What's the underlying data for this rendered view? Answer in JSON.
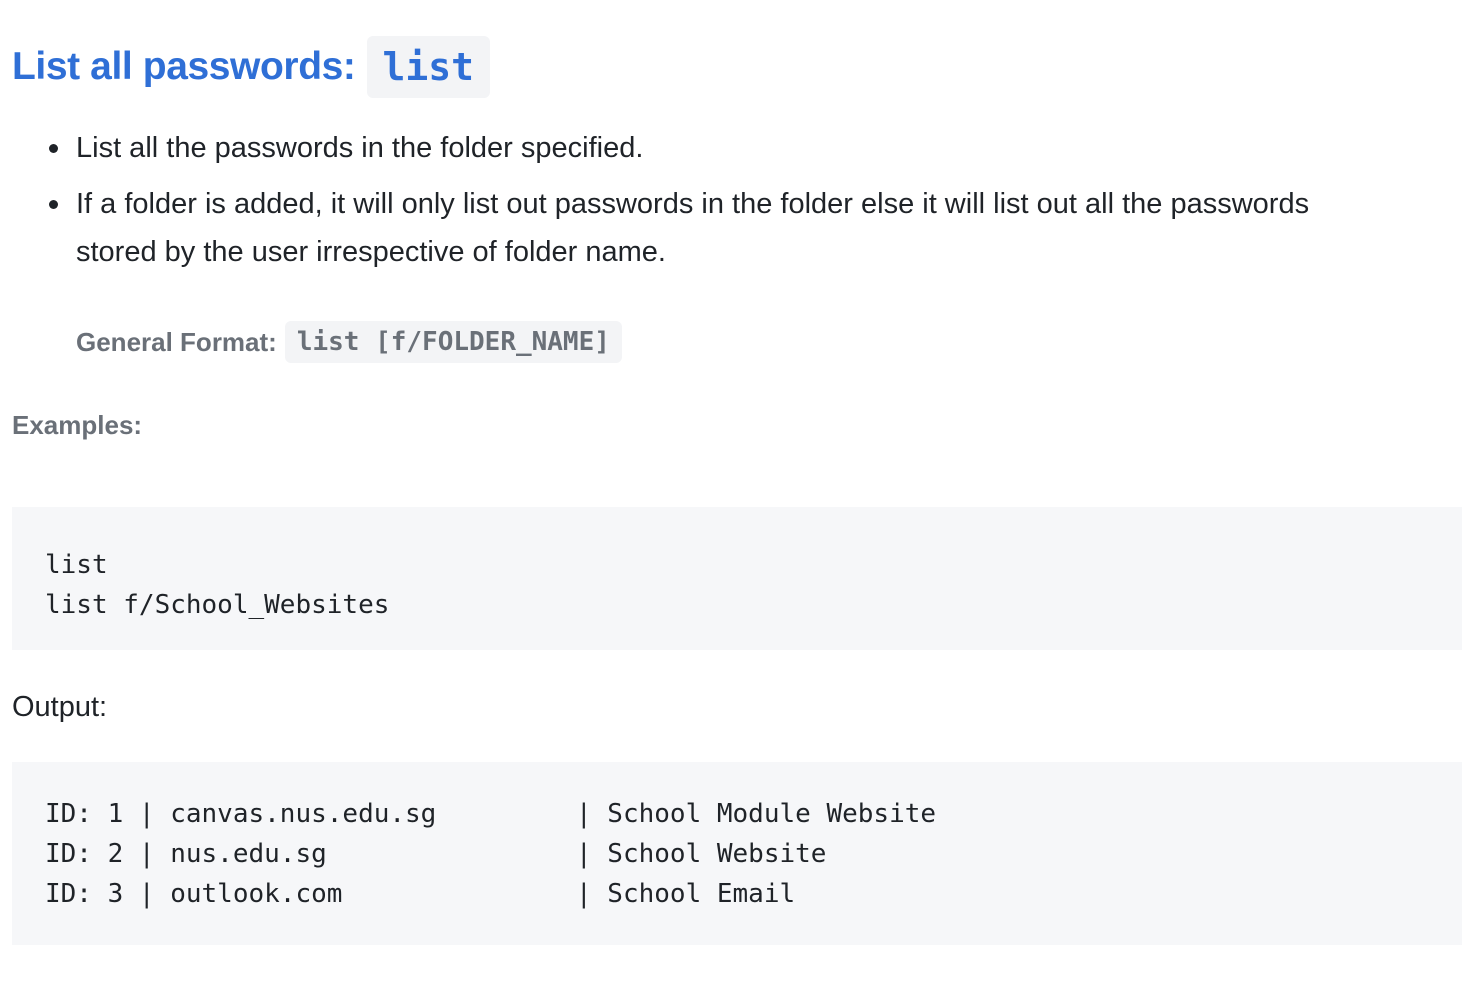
{
  "heading": {
    "text": "List all passwords:",
    "code": "list"
  },
  "bullets": [
    {
      "text": "List all the passwords in the folder specified."
    },
    {
      "text": "If a folder is added, it will only list out passwords in the folder else it will list out all the passwords",
      "text_cont": "stored by the user irrespective of folder name."
    }
  ],
  "format": {
    "label": "General Format:",
    "code": "list [f/FOLDER_NAME]"
  },
  "examples": {
    "label": "Examples:",
    "lines": [
      "list",
      "list f/School_Websites"
    ]
  },
  "output": {
    "label": "Output:",
    "rows": [
      {
        "main": "ID: 1 | canvas.nus.edu.sg",
        "desc": "| School Module Website"
      },
      {
        "main": "ID: 2 | nus.edu.sg",
        "desc": "| School Website"
      },
      {
        "main": "ID: 3 | outlook.com",
        "desc": "| School Email"
      }
    ]
  },
  "colors": {
    "heading": "#2f6fd6",
    "muted_label": "#6a7078",
    "code_background": "#f6f7f9"
  }
}
